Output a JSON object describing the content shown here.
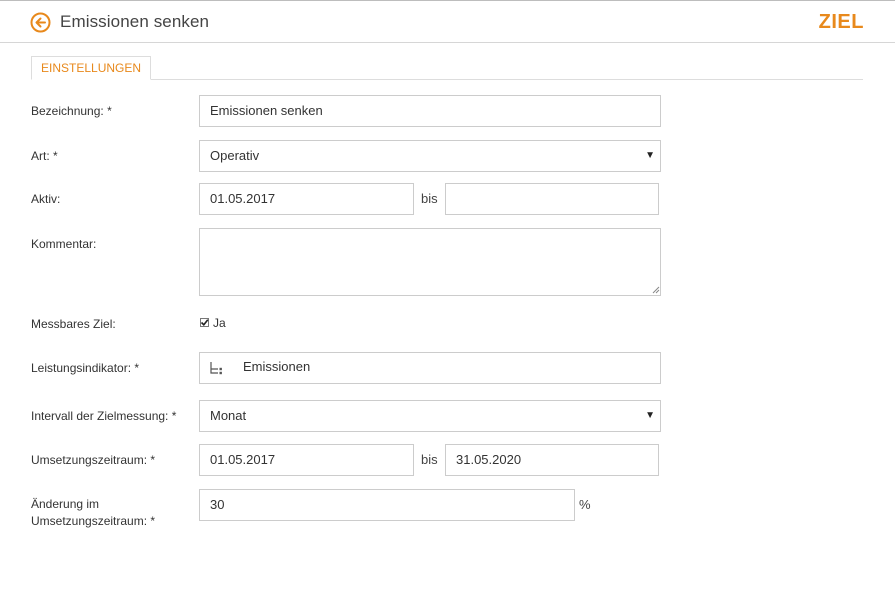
{
  "header": {
    "title": "Emissionen senken",
    "entity": "ZIEL",
    "accent_color": "#e8891c",
    "back_icon": "arrow-left-circle-icon"
  },
  "tabs": [
    {
      "label": "EINSTELLUNGEN",
      "active": true
    }
  ],
  "form": {
    "bezeichnung": {
      "label": "Bezeichnung:",
      "required": "*",
      "value": "Emissionen senken"
    },
    "art": {
      "label": "Art:",
      "required": "*",
      "value": "Operativ",
      "caret": "▼"
    },
    "aktiv": {
      "label": "Aktiv:",
      "from": "01.05.2017",
      "separator": "bis",
      "to": ""
    },
    "kommentar": {
      "label": "Kommentar:",
      "value": ""
    },
    "messbares_ziel": {
      "label": "Messbares Ziel:",
      "checked": true,
      "option_label": "Ja"
    },
    "leistungsindikator": {
      "label": "Leistungsindikator:",
      "required": "*",
      "value": "Emissionen",
      "icon": "hierarchy-tree-icon"
    },
    "intervall": {
      "label": "Intervall der Zielmessung:",
      "required": "*",
      "value": "Monat",
      "caret": "▼"
    },
    "umsetzungszeitraum": {
      "label": "Umsetzungszeitraum:",
      "required": "*",
      "from": "01.05.2017",
      "separator": "bis",
      "to": "31.05.2020"
    },
    "aenderung": {
      "label_line1": "Änderung im",
      "label_line2": "Umsetzungszeitraum:",
      "required": "*",
      "value": "30",
      "unit": "%"
    }
  }
}
